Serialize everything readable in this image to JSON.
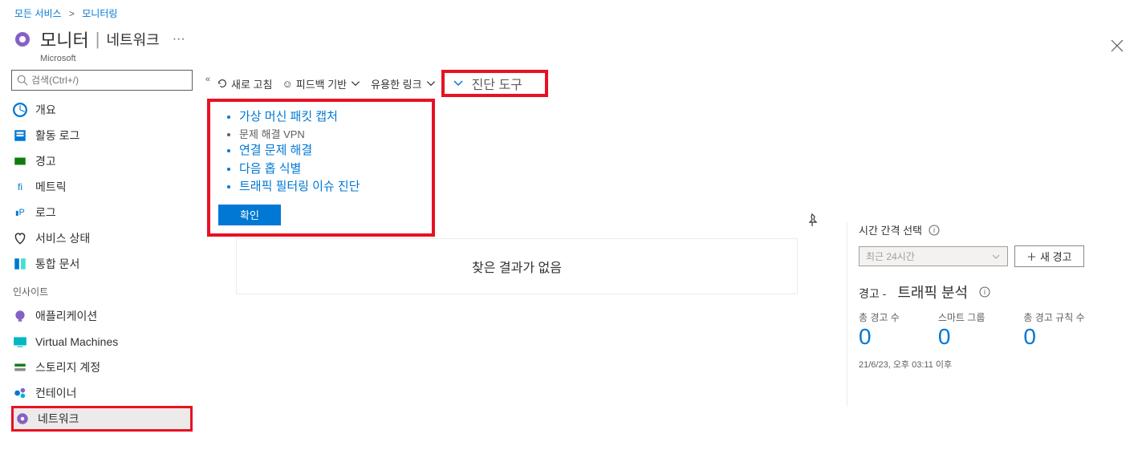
{
  "breadcrumb": {
    "all_services": "모든 서비스",
    "sep": ">",
    "monitoring": "모니터링"
  },
  "header": {
    "title": "모니터",
    "sep": "|",
    "sub": "네트워크",
    "dots": "···",
    "company": "Microsoft"
  },
  "search": {
    "placeholder": "검색(Ctrl+/)"
  },
  "sidebar": {
    "items": [
      {
        "label": "개요"
      },
      {
        "label": "활동 로그"
      },
      {
        "label": "경고"
      },
      {
        "label": "메트릭"
      },
      {
        "label": "로그"
      },
      {
        "label": "서비스 상태"
      },
      {
        "label": "통합 문서"
      }
    ],
    "section": "인사이트",
    "insights": [
      {
        "label": "애플리케이션"
      },
      {
        "label": "Virtual Machines"
      },
      {
        "label": "스토리지 계정"
      },
      {
        "label": "컨테이너"
      },
      {
        "label": "네트워크"
      }
    ]
  },
  "toolbar": {
    "refresh": "새로 고침",
    "feedback": "피드백 기반",
    "links": "유용한 링크",
    "diag": "진단 도구"
  },
  "dropdown": {
    "items": [
      {
        "label": "가상 머신 패킷 캡처",
        "link": true
      },
      {
        "label": "문제 해결 VPN",
        "link": false
      },
      {
        "label": "연결 문제 해결",
        "link": true
      },
      {
        "label": "다음 홉 식별",
        "link": true
      },
      {
        "label": "트래픽 필터링 이슈 진단",
        "link": true
      }
    ],
    "ok": "확인"
  },
  "no_result": "찾은 결과가 없음",
  "right": {
    "time_label": "시간 간격 선택",
    "time_value": "최근 24시간",
    "new_alert": "새 경고",
    "alert_prefix": "경고 -",
    "alert_title": "트래픽 분석",
    "metrics": [
      {
        "label": "총 경고 수",
        "value": "0"
      },
      {
        "label": "스마트 그룹",
        "value": "0"
      },
      {
        "label": "총 경고 규칙 수",
        "value": "0"
      }
    ],
    "timestamp": "21/6/23, 오후 03:11 이후"
  },
  "icons": {
    "fi": "fi",
    "p": "P"
  }
}
